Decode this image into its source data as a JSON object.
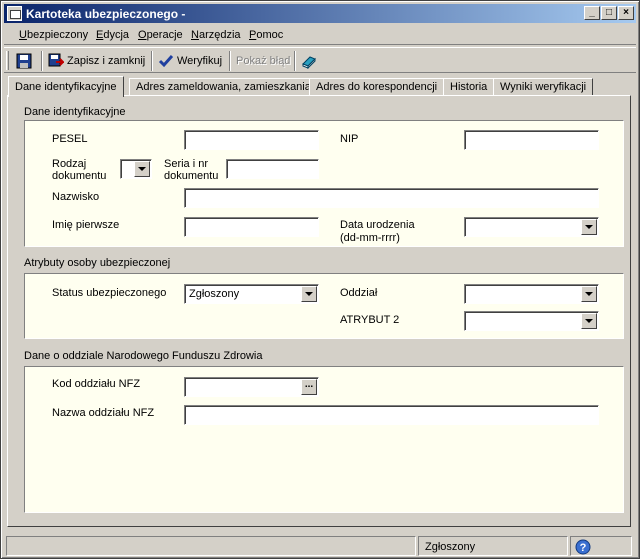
{
  "window": {
    "title": "Kartoteka ubezpieczonego -",
    "controls": {
      "minimize": "_",
      "maximize": "□",
      "close": "×"
    }
  },
  "menu": [
    {
      "label": "Ubezpieczony",
      "underline": "U"
    },
    {
      "label": "Edycja",
      "underline": "E"
    },
    {
      "label": "Operacje",
      "underline": "O"
    },
    {
      "label": "Narzędzia",
      "underline": "N"
    },
    {
      "label": "Pomoc",
      "underline": "P"
    }
  ],
  "toolbar": {
    "save_close_label": "Zapisz i zamknij",
    "verify_label": "Weryfikuj",
    "show_error_label": "Pokaż błąd"
  },
  "tabs": [
    "Dane identyfikacyjne",
    "Adres zameldowania, zamieszkania",
    "Adres do korespondencji",
    "Historia",
    "Wyniki weryfikacji"
  ],
  "sections": {
    "identification": {
      "title": "Dane identyfikacyjne",
      "pesel_label": "PESEL",
      "pesel_value": "",
      "nip_label": "NIP",
      "nip_value": "",
      "doc_type_label_1": "Rodzaj",
      "doc_type_label_2": "dokumentu",
      "doc_type_value": "",
      "doc_series_label_1": "Seria i nr",
      "doc_series_label_2": "dokumentu",
      "doc_series_value": "",
      "surname_label": "Nazwisko",
      "surname_value": "",
      "first_name_label": "Imię pierwsze",
      "first_name_value": "",
      "birth_date_label_1": "Data urodzenia",
      "birth_date_label_2": "(dd-mm-rrrr)",
      "birth_date_value": ""
    },
    "attributes": {
      "title": "Atrybuty osoby ubezpieczonej",
      "status_label": "Status ubezpieczonego",
      "status_value": "Zgłoszony",
      "branch_label": "Oddział",
      "branch_value": "",
      "attr2_label": "ATRYBUT 2",
      "attr2_value": ""
    },
    "nfz": {
      "title": "Dane o oddziale Narodowego Funduszu Zdrowia",
      "code_label": "Kod oddziału NFZ",
      "code_value": "",
      "code_button": "...",
      "name_label": "Nazwa oddziału NFZ",
      "name_value": ""
    }
  },
  "statusbar": {
    "status_text": "Zgłoszony",
    "help_glyph": "?"
  }
}
